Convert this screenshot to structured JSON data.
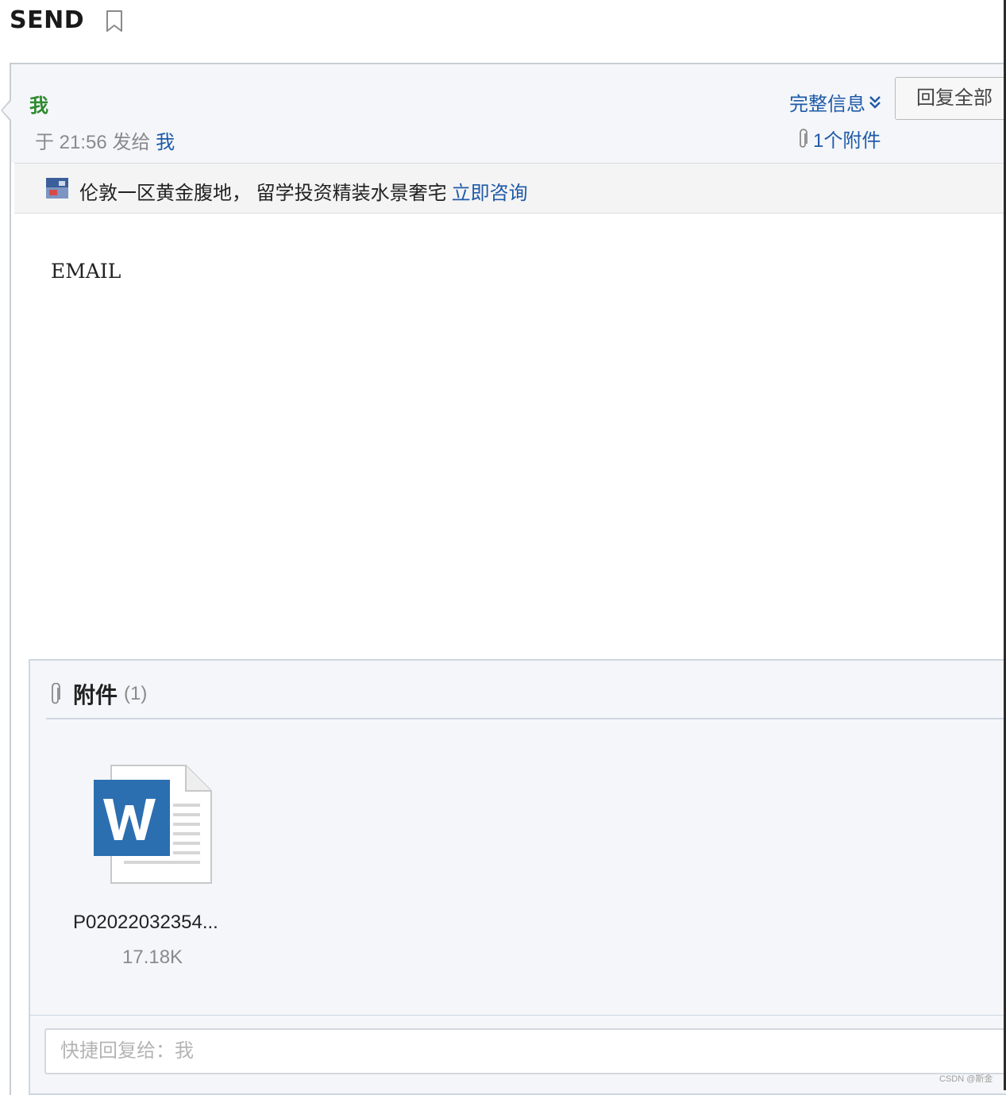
{
  "page": {
    "subject": "SEND"
  },
  "header": {
    "sender": "我",
    "time_prefix": "于 21:56 发给",
    "recipient": "我",
    "full_info": "完整信息",
    "attachment_summary": "1个附件",
    "reply_all": "回复全部"
  },
  "ad": {
    "text": "伦敦一区黄金腹地， 留学投资精装水景奢宅",
    "link": "立即咨询"
  },
  "body": {
    "text": "EMAIL"
  },
  "attachments": {
    "title": "附件",
    "count": "(1)",
    "items": [
      {
        "name": "P02022032354...",
        "size": "17.18K",
        "icon": "word-doc-icon"
      }
    ]
  },
  "quick_reply": {
    "placeholder": "快捷回复给：我"
  },
  "watermark": "CSDN @斯金",
  "colors": {
    "link": "#1e5aa8",
    "sender": "#2f8a2f",
    "panel_bg": "#f4f6f9",
    "word_blue": "#2b6fb0"
  }
}
